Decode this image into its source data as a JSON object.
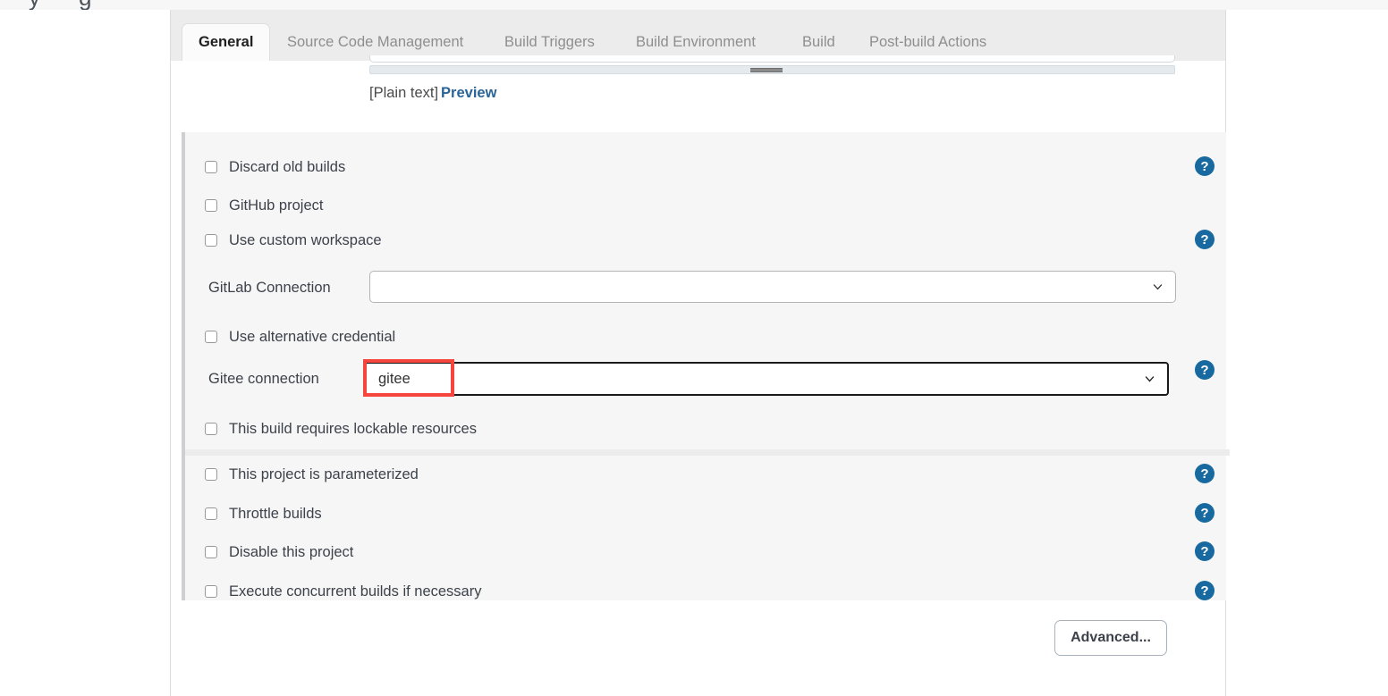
{
  "page": {
    "clipped_heading_glyph_1": "y",
    "clipped_heading_glyph_2": "g"
  },
  "tabs": [
    {
      "label": "General",
      "active": true
    },
    {
      "label": "Source Code Management",
      "active": false
    },
    {
      "label": "Build Triggers",
      "active": false
    },
    {
      "label": "Build Environment",
      "active": false
    },
    {
      "label": "Build",
      "active": false
    },
    {
      "label": "Post-build Actions",
      "active": false
    }
  ],
  "description_area": {
    "markup_type_label": "[Plain text]",
    "preview_link_label": "Preview",
    "resize_grip_name": "resize-grip-icon"
  },
  "form": {
    "checkboxes_top": [
      {
        "label": "Discard old builds",
        "checked": false,
        "has_help": true
      },
      {
        "label": "GitHub project",
        "checked": false,
        "has_help": false
      },
      {
        "label": "Use custom workspace",
        "checked": false,
        "has_help": true
      }
    ],
    "gitlab_connection": {
      "label": "GitLab Connection",
      "value": "",
      "placeholder": "",
      "focused": false,
      "has_help": false
    },
    "use_alternative_credential": {
      "label": "Use alternative credential",
      "checked": false
    },
    "gitee_connection": {
      "label": "Gitee connection",
      "value": "gitee",
      "focused": true,
      "has_help": true
    },
    "lockable_resources": {
      "label": "This build requires lockable resources",
      "checked": false
    },
    "checkboxes_bottom": [
      {
        "label": "This project is parameterized",
        "checked": false,
        "has_help": true
      },
      {
        "label": "Throttle builds",
        "checked": false,
        "has_help": true
      },
      {
        "label": "Disable this project",
        "checked": false,
        "has_help": true
      },
      {
        "label": "Execute concurrent builds if necessary",
        "checked": false,
        "has_help": true
      }
    ],
    "advanced_button_label": "Advanced..."
  },
  "icons": {
    "help": "?",
    "chevron_down": "chevron-down-icon"
  },
  "colors": {
    "help_blue": "#18699f",
    "link_blue": "#2a6496",
    "annotation_red": "#f5453c",
    "section_bg": "#f6f6f7",
    "tabbar_bg": "#ececec"
  }
}
